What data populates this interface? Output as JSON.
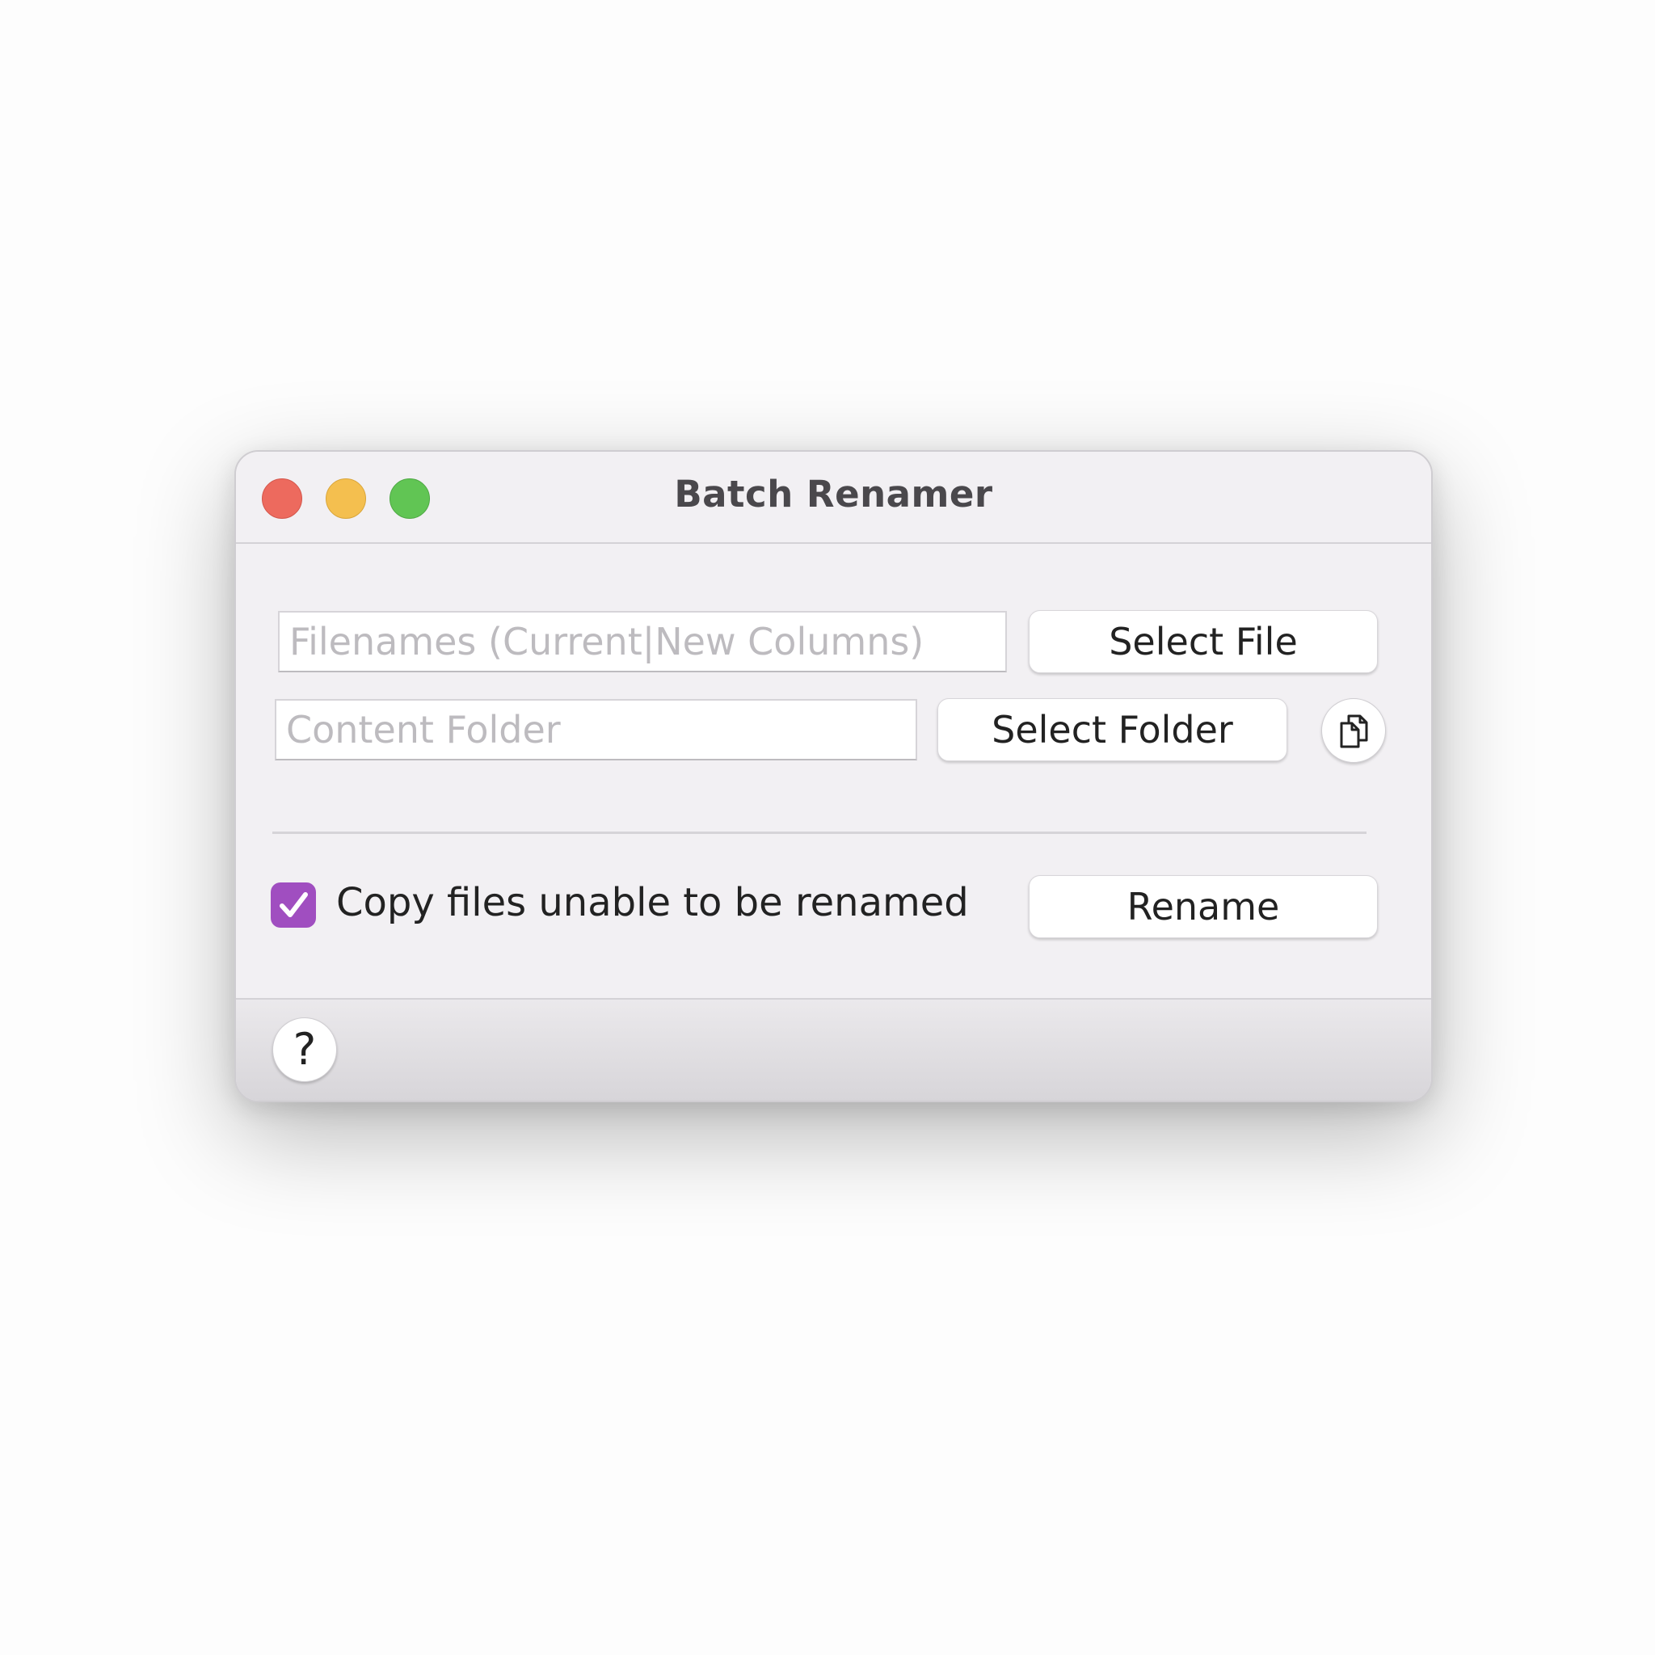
{
  "window": {
    "title": "Batch Renamer"
  },
  "filenames_field": {
    "placeholder": "Filenames (Current|New Columns)",
    "value": ""
  },
  "select_file_button": {
    "label": "Select File"
  },
  "content_folder_field": {
    "placeholder": "Content Folder",
    "value": ""
  },
  "select_folder_button": {
    "label": "Select Folder"
  },
  "copy_button": {
    "icon": "copy-documents-icon"
  },
  "copy_files_checkbox": {
    "label": "Copy files unable to be renamed",
    "checked": true,
    "color": "#a04ec0"
  },
  "rename_button": {
    "label": "Rename"
  },
  "help_button": {
    "label": "?"
  },
  "colors": {
    "close": "#ed6a5e",
    "minimize": "#f4bf4f",
    "maximize": "#61c554"
  }
}
